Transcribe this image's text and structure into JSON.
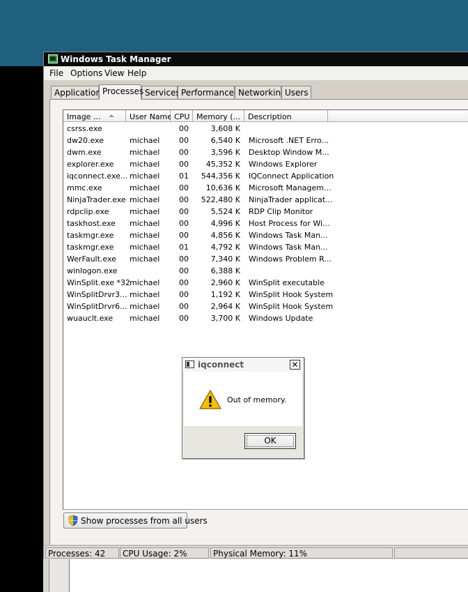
{
  "window": {
    "title": "Windows Task Manager"
  },
  "menu": [
    "File",
    "Options",
    "View",
    "Help"
  ],
  "tabs": [
    "Applications",
    "Processes",
    "Services",
    "Performance",
    "Networking",
    "Users"
  ],
  "active_tab": "Processes",
  "columns": [
    "Image ...",
    "User Name",
    "CPU",
    "Memory (...",
    "Description"
  ],
  "processes": [
    {
      "image": "csrss.exe",
      "user": "",
      "cpu": "00",
      "memory": "3,608 K",
      "description": ""
    },
    {
      "image": "dw20.exe",
      "user": "michael",
      "cpu": "00",
      "memory": "6,540 K",
      "description": "Microsoft .NET Erro..."
    },
    {
      "image": "dwm.exe",
      "user": "michael",
      "cpu": "00",
      "memory": "3,596 K",
      "description": "Desktop Window M..."
    },
    {
      "image": "explorer.exe",
      "user": "michael",
      "cpu": "00",
      "memory": "45,352 K",
      "description": "Windows Explorer"
    },
    {
      "image": "iqconnect.exe...",
      "user": "michael",
      "cpu": "01",
      "memory": "544,356 K",
      "description": "IQConnect Application"
    },
    {
      "image": "mmc.exe",
      "user": "michael",
      "cpu": "00",
      "memory": "10,636 K",
      "description": "Microsoft Managem..."
    },
    {
      "image": "NinjaTrader.exe",
      "user": "michael",
      "cpu": "00",
      "memory": "522,480 K",
      "description": "NinjaTrader applicat..."
    },
    {
      "image": "rdpclip.exe",
      "user": "michael",
      "cpu": "00",
      "memory": "5,524 K",
      "description": "RDP Clip Monitor"
    },
    {
      "image": "taskhost.exe",
      "user": "michael",
      "cpu": "00",
      "memory": "4,996 K",
      "description": "Host Process for Wi..."
    },
    {
      "image": "taskmgr.exe",
      "user": "michael",
      "cpu": "00",
      "memory": "4,856 K",
      "description": "Windows Task Man..."
    },
    {
      "image": "taskmgr.exe",
      "user": "michael",
      "cpu": "01",
      "memory": "4,792 K",
      "description": "Windows Task Man..."
    },
    {
      "image": "WerFault.exe",
      "user": "michael",
      "cpu": "00",
      "memory": "7,340 K",
      "description": "Windows Problem R..."
    },
    {
      "image": "winlogon.exe",
      "user": "",
      "cpu": "00",
      "memory": "6,388 K",
      "description": ""
    },
    {
      "image": "WinSplit.exe *32",
      "user": "michael",
      "cpu": "00",
      "memory": "2,960 K",
      "description": "WinSplit executable"
    },
    {
      "image": "WinSplitDrvr3...",
      "user": "michael",
      "cpu": "00",
      "memory": "1,192 K",
      "description": "WinSplit Hook System"
    },
    {
      "image": "WinSplitDrvr6...",
      "user": "michael",
      "cpu": "00",
      "memory": "2,964 K",
      "description": "WinSplit Hook System"
    },
    {
      "image": "wuauclt.exe",
      "user": "michael",
      "cpu": "00",
      "memory": "3,700 K",
      "description": "Windows Update"
    }
  ],
  "show_all_button": "Show processes from all users",
  "status": {
    "processes": "Processes: 42",
    "cpu": "CPU Usage: 2%",
    "memory": "Physical Memory: 11%"
  },
  "dialog": {
    "title": "iqconnect",
    "message": "Out of memory.",
    "ok": "OK",
    "close": "✕"
  },
  "icons": {
    "app": "task-manager-icon",
    "uac": "shield-icon",
    "warning": "warning-icon"
  },
  "colors": {
    "desktop": "#1f5f80",
    "titlebar": "#0b0b0b",
    "warning": "#f5c000"
  }
}
